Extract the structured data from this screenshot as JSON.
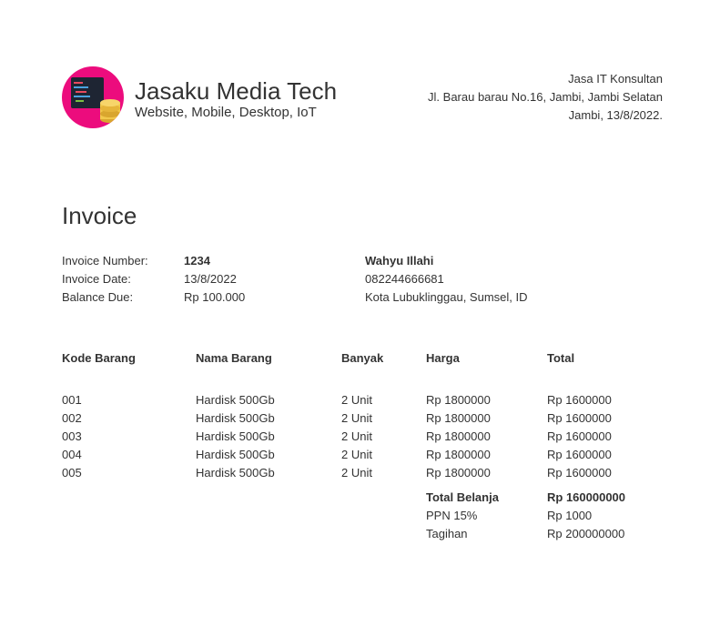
{
  "header": {
    "company_name": "Jasaku Media Tech",
    "tagline": "Website, Mobile, Desktop, IoT",
    "address_lines": [
      "Jasa IT Konsultan",
      "Jl. Barau barau No.16, Jambi, Jambi Selatan",
      "Jambi, 13/8/2022."
    ],
    "logo_colors": {
      "background": "#ec0c7d",
      "monitor": "#1e2533",
      "coins": "#f2c84b"
    }
  },
  "invoice": {
    "title": "Invoice",
    "fields": [
      {
        "label": "Invoice Number:",
        "value": "1234"
      },
      {
        "label": "Invoice Date:",
        "value": "13/8/2022"
      },
      {
        "label": "Balance Due:",
        "value": "Rp 100.000"
      }
    ],
    "customer": {
      "name": "Wahyu Illahi",
      "phone": "082244666681",
      "address": "Kota Lubuklinggau, Sumsel, ID"
    }
  },
  "table": {
    "headers": [
      "Kode Barang",
      "Nama Barang",
      "Banyak",
      "Harga",
      "Total"
    ],
    "rows": [
      [
        "001",
        "Hardisk 500Gb",
        "2 Unit",
        "Rp 1800000",
        "Rp 1600000"
      ],
      [
        "002",
        "Hardisk 500Gb",
        "2 Unit",
        "Rp 1800000",
        "Rp 1600000"
      ],
      [
        "003",
        "Hardisk 500Gb",
        "2 Unit",
        "Rp 1800000",
        "Rp 1600000"
      ],
      [
        "004",
        "Hardisk 500Gb",
        "2 Unit",
        "Rp 1800000",
        "Rp 1600000"
      ],
      [
        "005",
        "Hardisk 500Gb",
        "2 Unit",
        "Rp 1800000",
        "Rp 1600000"
      ]
    ]
  },
  "summary": [
    {
      "label": "Total Belanja",
      "value": "Rp 160000000"
    },
    {
      "label": "PPN 15%",
      "value": "Rp 1000"
    },
    {
      "label": "Tagihan",
      "value": "Rp 200000000"
    }
  ]
}
